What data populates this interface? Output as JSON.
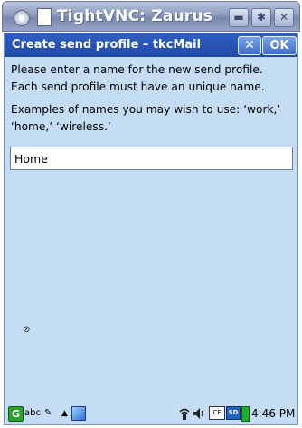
{
  "vnc_window": {
    "title": "TightVNC: Zaurus",
    "buttons": {
      "minimize": "▬",
      "maximize": "✱",
      "close": "✕"
    }
  },
  "dialog": {
    "title": "Create send profile – tkcMail",
    "close_label": "✕",
    "ok_label": "OK",
    "instructions_line1": "Please enter a name for the new send profile.",
    "instructions_line2": "Each send profile must have an unique name.",
    "examples": "Examples of names you may wish to use: ‘work,’ ‘home,’ ‘wireless.’",
    "input_value": "Home",
    "cursor_glyph": "⊘"
  },
  "taskbar": {
    "start_icon": "G",
    "input_method": "abc",
    "pen_icon": "✎",
    "arrow_icon": "▲",
    "cf_label": "CF",
    "sd_label": "SD",
    "clock": "4:46 PM"
  },
  "icons": {
    "vnc_menu": "vnc-menu-icon",
    "document": "document-icon",
    "wifi": "wifi-icon",
    "speaker": "speaker-icon",
    "battery": "battery-icon"
  }
}
